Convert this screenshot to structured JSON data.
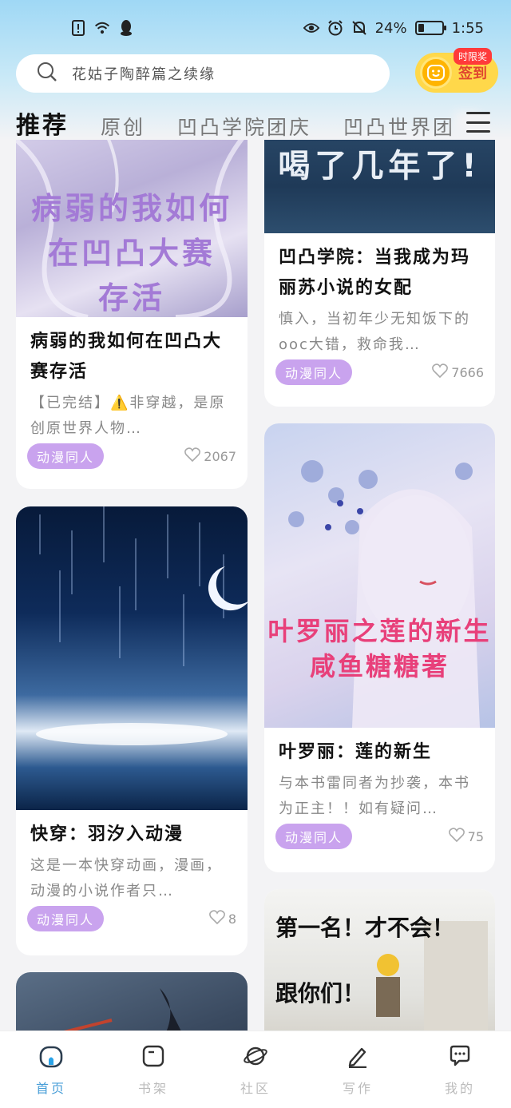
{
  "status": {
    "battery": "24%",
    "time": "1:55"
  },
  "search": {
    "placeholder": "花姑子陶醉篇之续缘"
  },
  "signin": {
    "label": "签到",
    "badge": "时限奖"
  },
  "tabs": [
    {
      "label": "推荐",
      "active": true
    },
    {
      "label": "原创"
    },
    {
      "label": "凹凸学院团庆"
    },
    {
      "label": "凹凸世界团"
    }
  ],
  "cards": [
    {
      "cover_text": "病弱的我如何\n在凹凸大赛\n存活",
      "title": "病弱的我如何在凹凸大赛存活",
      "desc": "【已完结】⚠️非穿越，是原创原世界人物…",
      "tag": "动漫同人",
      "likes": "2067"
    },
    {
      "cover_text": "喝了几年了!",
      "title": "凹凸学院：当我成为玛丽苏小说的女配",
      "desc": "慎入，当初年少无知饭下的ooc大错，救命我…",
      "tag": "动漫同人",
      "likes": "7666"
    },
    {
      "title": "快穿：羽汐入动漫",
      "desc": "这是一本快穿动画，漫画，动漫的小说作者只…",
      "tag": "动漫同人",
      "likes": "8"
    },
    {
      "cover_text": "叶罗丽之莲的新生\n咸鱼糖糖著",
      "title": "叶罗丽：莲的新生",
      "desc": "与本书雷同者为抄袭，本书为正主！！如有疑问…",
      "tag": "动漫同人",
      "likes": "75"
    },
    {
      "cover_text": "第一名！才不会！\n跟你们！"
    }
  ],
  "nav": [
    {
      "label": "首页",
      "icon": "home-icon",
      "active": true
    },
    {
      "label": "书架",
      "icon": "bookshelf-icon"
    },
    {
      "label": "社区",
      "icon": "planet-icon"
    },
    {
      "label": "写作",
      "icon": "pen-icon"
    },
    {
      "label": "我的",
      "icon": "chat-icon"
    }
  ],
  "colors": {
    "tag": "#c9a3ee",
    "accent": "#4a9fd8"
  }
}
